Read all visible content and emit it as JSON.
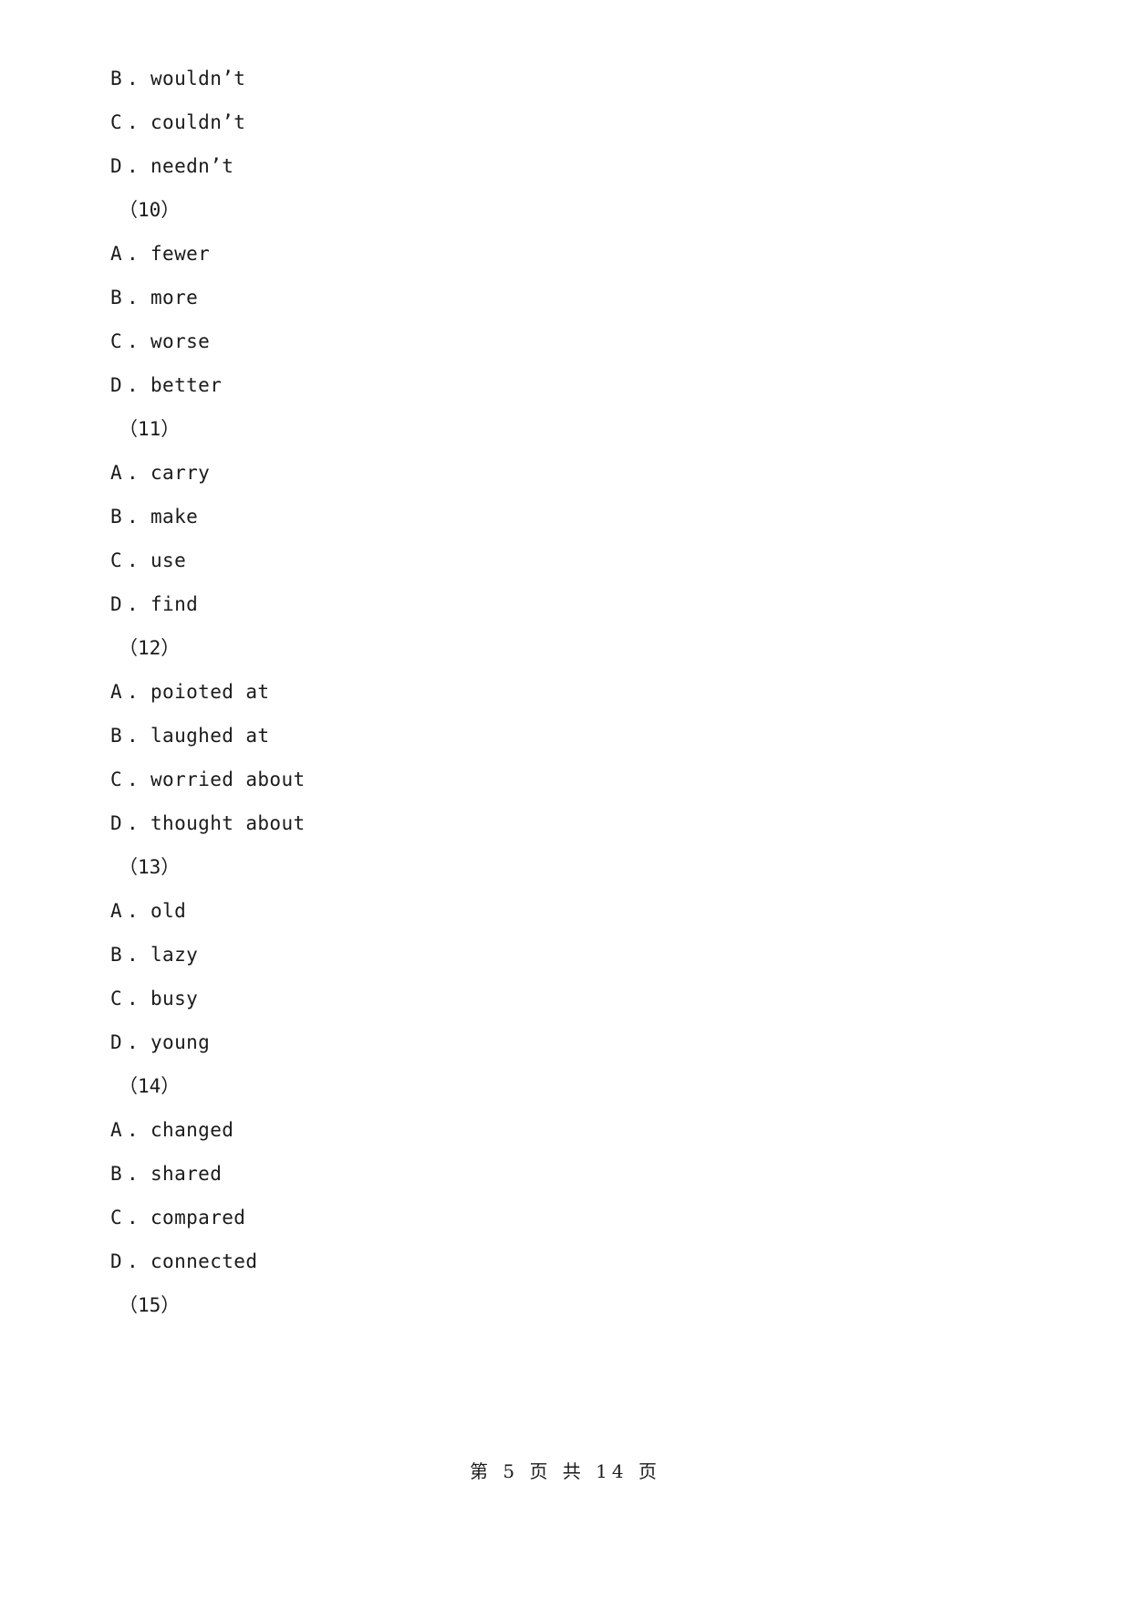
{
  "document": {
    "page_background": "#ffffff",
    "text_color": "#1b1b1b",
    "lines": [
      {
        "kind": "option",
        "letter": "B",
        "dot": ".",
        "text": "wouldn’t"
      },
      {
        "kind": "option",
        "letter": "C",
        "dot": ".",
        "text": "couldn’t"
      },
      {
        "kind": "option",
        "letter": "D",
        "dot": ".",
        "text": "needn’t"
      },
      {
        "kind": "qnum",
        "label": "（10）"
      },
      {
        "kind": "option",
        "letter": "A",
        "dot": ".",
        "text": "fewer"
      },
      {
        "kind": "option",
        "letter": "B",
        "dot": ".",
        "text": "more"
      },
      {
        "kind": "option",
        "letter": "C",
        "dot": ".",
        "text": "worse"
      },
      {
        "kind": "option",
        "letter": "D",
        "dot": ".",
        "text": "better"
      },
      {
        "kind": "qnum",
        "label": "（11）"
      },
      {
        "kind": "option",
        "letter": "A",
        "dot": ".",
        "text": "carry"
      },
      {
        "kind": "option",
        "letter": "B",
        "dot": ".",
        "text": "make"
      },
      {
        "kind": "option",
        "letter": "C",
        "dot": ".",
        "text": "use"
      },
      {
        "kind": "option",
        "letter": "D",
        "dot": ".",
        "text": "find"
      },
      {
        "kind": "qnum",
        "label": "（12）"
      },
      {
        "kind": "option",
        "letter": "A",
        "dot": ".",
        "text": "poioted at"
      },
      {
        "kind": "option",
        "letter": "B",
        "dot": ".",
        "text": "laughed at"
      },
      {
        "kind": "option",
        "letter": "C",
        "dot": ".",
        "text": "worried about"
      },
      {
        "kind": "option",
        "letter": "D",
        "dot": ".",
        "text": "thought about"
      },
      {
        "kind": "qnum",
        "label": "（13）"
      },
      {
        "kind": "option",
        "letter": "A",
        "dot": ".",
        "text": "old"
      },
      {
        "kind": "option",
        "letter": "B",
        "dot": ".",
        "text": "lazy"
      },
      {
        "kind": "option",
        "letter": "C",
        "dot": ".",
        "text": "busy"
      },
      {
        "kind": "option",
        "letter": "D",
        "dot": ".",
        "text": "young"
      },
      {
        "kind": "qnum",
        "label": "（14）"
      },
      {
        "kind": "option",
        "letter": "A",
        "dot": ".",
        "text": "changed"
      },
      {
        "kind": "option",
        "letter": "B",
        "dot": ".",
        "text": "shared"
      },
      {
        "kind": "option",
        "letter": "C",
        "dot": ".",
        "text": "compared"
      },
      {
        "kind": "option",
        "letter": "D",
        "dot": ".",
        "text": "connected"
      },
      {
        "kind": "qnum",
        "label": "（15）"
      }
    ]
  },
  "footer": {
    "page_label_prefix": "第",
    "current_page": "5",
    "page_unit": "页",
    "total_prefix": "共",
    "total_pages": "14",
    "total_unit": "页",
    "full_text": "第 5 页 共 14 页"
  }
}
